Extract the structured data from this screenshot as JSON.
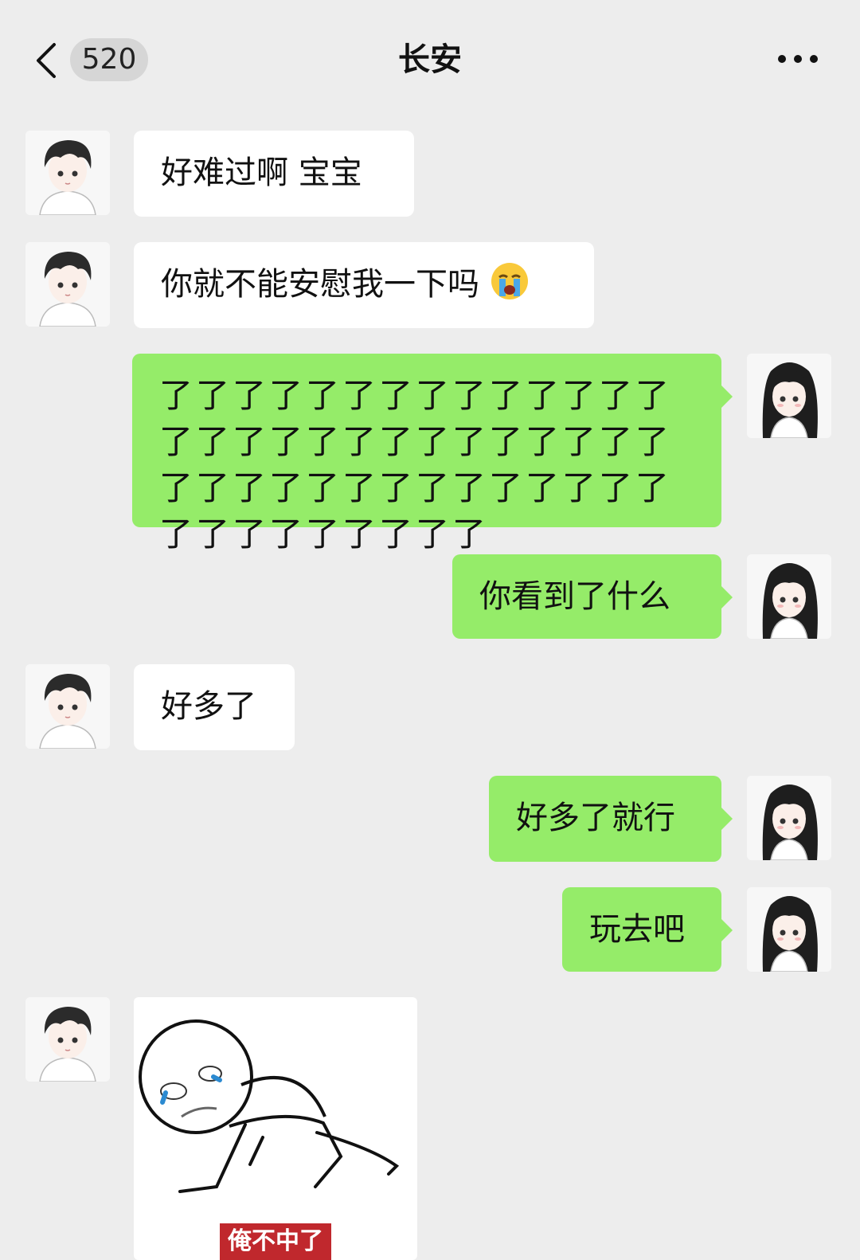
{
  "header": {
    "back_icon": "chevron-left-icon",
    "unread_count": "520",
    "title": "长安",
    "more_icon": "more-dots-icon"
  },
  "messages": [
    {
      "side": "in",
      "text": "好难过啊 宝宝"
    },
    {
      "side": "in",
      "text": "你就不能安慰我一下吗",
      "emoji": "crying-face"
    },
    {
      "side": "out",
      "text": "了了了了了了了了了了了了了了了了了了了了了了了了了了了了了了了了了了了了了了了了了了了了了了了了了了了"
    },
    {
      "side": "out",
      "text": "你看到了什么"
    },
    {
      "side": "in",
      "text": "好多了"
    },
    {
      "side": "out",
      "text": "好多了就行"
    },
    {
      "side": "out",
      "text": "玩去吧"
    },
    {
      "side": "in",
      "type": "sticker",
      "caption": "俺不中了"
    }
  ],
  "colors": {
    "background": "#ededed",
    "outgoing_bubble": "#95ec69",
    "incoming_bubble": "#ffffff",
    "badge": "#d6d6d6",
    "sticker_caption_bg": "#c0282d"
  }
}
